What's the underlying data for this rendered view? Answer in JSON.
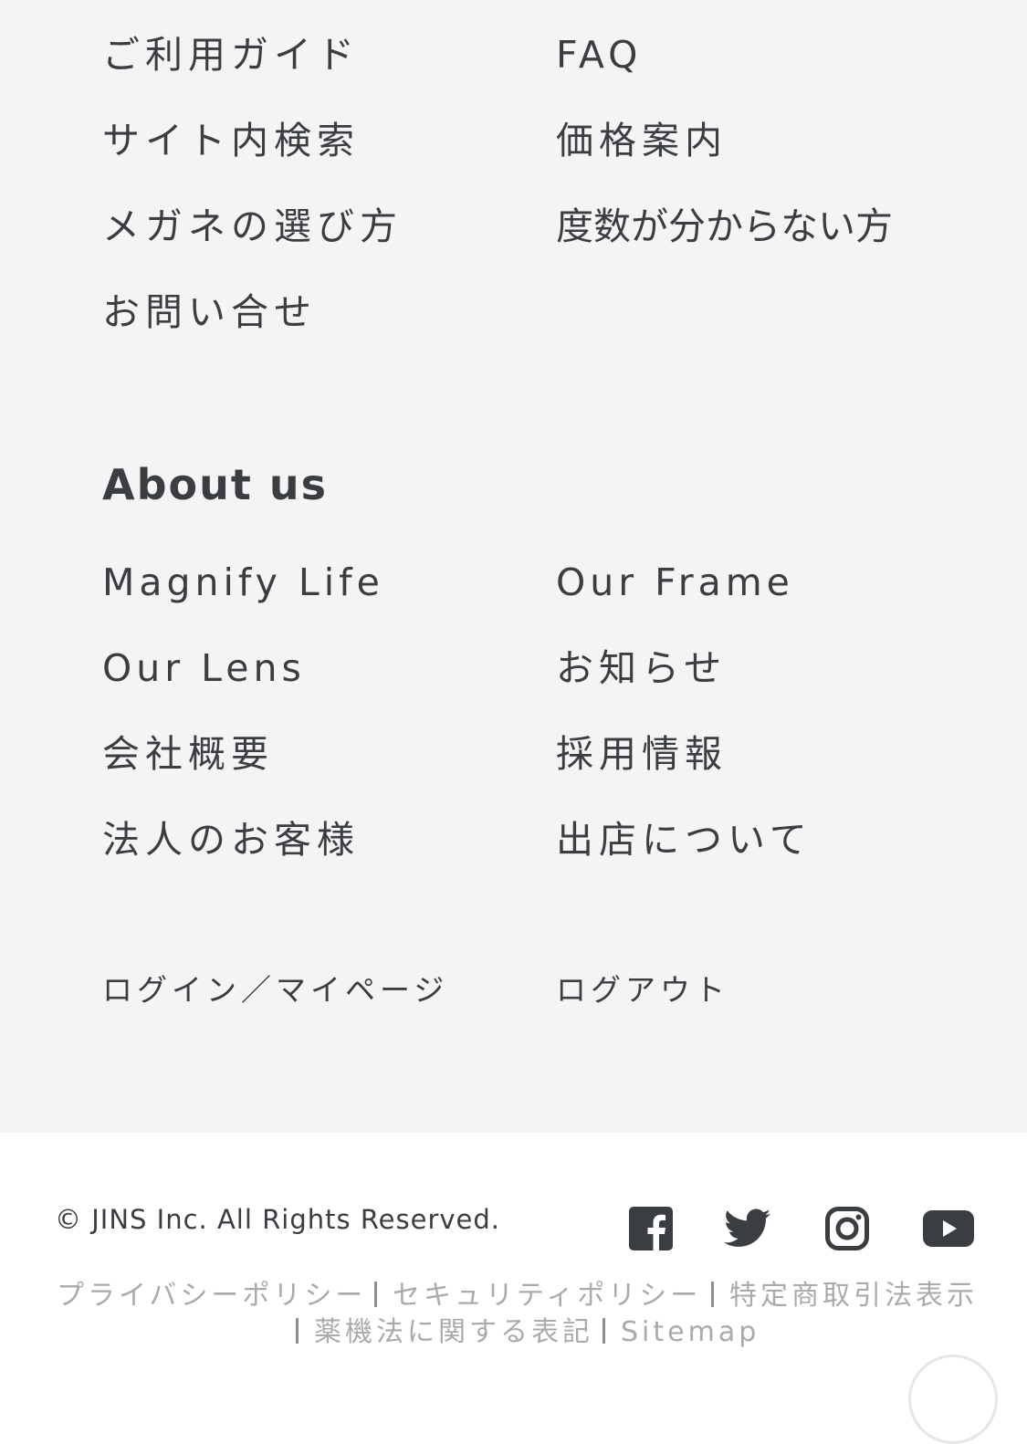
{
  "support_links": {
    "guide": "ご利用ガイド",
    "faq": "FAQ",
    "site_search": "サイト内検索",
    "price_guide": "価格案内",
    "how_to_choose": "メガネの選び方",
    "unknown_power": "度数が分からない方",
    "contact": "お問い合せ"
  },
  "about": {
    "heading": "About us",
    "magnify_life": "Magnify Life",
    "our_frame": "Our Frame",
    "our_lens": "Our Lens",
    "news": "お知らせ",
    "company": "会社概要",
    "recruit": "採用情報",
    "corporate": "法人のお客様",
    "store_opening": "出店について"
  },
  "account": {
    "login": "ログイン／マイページ",
    "logout": "ログアウト"
  },
  "footer": {
    "copyright": "© JINS Inc. All Rights Reserved.",
    "social": [
      "facebook-icon",
      "twitter-icon",
      "instagram-icon",
      "youtube-icon"
    ],
    "legal": {
      "privacy": "プライバシーポリシー",
      "security": "セキュリティポリシー",
      "commerce": "特定商取引法表示",
      "pharma": "薬機法に関する表記",
      "sitemap": "Sitemap"
    }
  },
  "colors": {
    "text": "#3a3d42",
    "gray_bg": "#f4f4f4",
    "legal_text": "#a8abae"
  }
}
